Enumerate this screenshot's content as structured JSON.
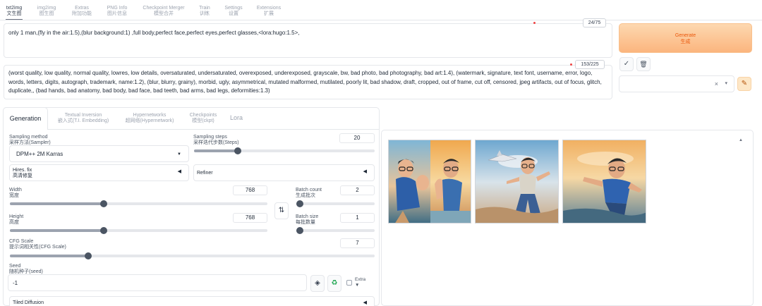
{
  "top_tabs": [
    {
      "en": "txt2img",
      "zh": "文生图",
      "active": true
    },
    {
      "en": "img2img",
      "zh": "图生图"
    },
    {
      "en": "Extras",
      "zh": "附加功能"
    },
    {
      "en": "PNG Info",
      "zh": "图片信息"
    },
    {
      "en": "Checkpoint Merger",
      "zh": "模型合并"
    },
    {
      "en": "Train",
      "zh": "训练"
    },
    {
      "en": "Settings",
      "zh": "设置"
    },
    {
      "en": "Extensions",
      "zh": "扩展"
    }
  ],
  "prompt": {
    "text": "only 1  man,(fly in the air:1.5),(blur background:1) ,full body,perfect face,perfect eyes,perfect glasses,<lora:hugo:1.5>,",
    "token_count": "24/75"
  },
  "negative_prompt": {
    "text": "(worst quality, low quality, normal quality, lowres, low details, oversaturated, undersaturated, overexposed, underexposed, grayscale, bw, bad photo, bad photography, bad art:1.4), (watermark, signature, text font, username, error, logo, words, letters, digits, autograph, trademark, name:1.2), (blur, blurry, grainy), morbid, ugly, asymmetrical, mutated malformed, mutilated, poorly lit, bad shadow, draft, cropped, out of frame, cut off, censored, jpeg artifacts, out of focus, glitch, duplicate,, (bad hands, bad anatomy, bad body, bad face, bad teeth, bad arms, bad legs, deformities:1.3)",
    "token_count": "153/225"
  },
  "generate": {
    "en": "Generate",
    "zh": "生成"
  },
  "buttons": {
    "apply_icon": "✓",
    "trash_icon": "🗑",
    "edit_icon": "✎"
  },
  "style_select": {
    "clear": "×",
    "caret": "▾"
  },
  "sub_tabs": [
    {
      "en": "Generation",
      "active": true
    },
    {
      "en": "Textual Inversion",
      "zh": "嵌入式(T.I. Embedding)"
    },
    {
      "en": "Hypernetworks",
      "zh": "超网络(Hypernetwork)"
    },
    {
      "en": "Checkpoints",
      "zh": "模型(ckpt)"
    },
    {
      "en": "Lora"
    }
  ],
  "sampling_method": {
    "label": "Sampling method",
    "label_zh": "采样方法(Sampler)",
    "value": "DPM++ 2M Karras",
    "caret": "▼"
  },
  "sampling_steps": {
    "label": "Sampling steps",
    "label_zh": "采样迭代步数(Steps)",
    "value": "20",
    "fraction": 0.23
  },
  "hires_fix": {
    "label": "Hires. fix",
    "label_zh": "高清修复",
    "arrow": "◀"
  },
  "refiner": {
    "label": "Refiner",
    "arrow": "◀"
  },
  "width": {
    "label": "Width",
    "label_zh": "宽度",
    "value": "768",
    "fraction": 0.36
  },
  "height": {
    "label": "Height",
    "label_zh": "高度",
    "value": "768",
    "fraction": 0.36
  },
  "batch_count": {
    "label": "Batch count",
    "label_zh": "生成批次",
    "value": "2",
    "fraction": 0.0
  },
  "batch_size": {
    "label": "Batch size",
    "label_zh": "每批数量",
    "value": "1",
    "fraction": 0.0
  },
  "swap_icon": "⇅",
  "cfg_scale": {
    "label": "CFG Scale",
    "label_zh": "提示词相关性(CFG Scale)",
    "value": "7",
    "fraction": 0.21
  },
  "seed": {
    "label": "Seed",
    "label_zh": "随机种子(seed)",
    "value": "-1"
  },
  "seed_buttons": {
    "dice_icon": "◈",
    "recycle_icon": "♻"
  },
  "extra": {
    "label": "Extra",
    "arrow": "▼"
  },
  "tiled_diffusion": {
    "label": "Tiled Diffusion",
    "arrow": "◀"
  },
  "gallery": {
    "scroll_icon": "▲",
    "image_count": 3
  },
  "colors": {
    "accent": "#ea580c",
    "generate_top": "#fdd8b0",
    "generate_bottom": "#fbb57e",
    "slider_knob": "#4b5563"
  }
}
